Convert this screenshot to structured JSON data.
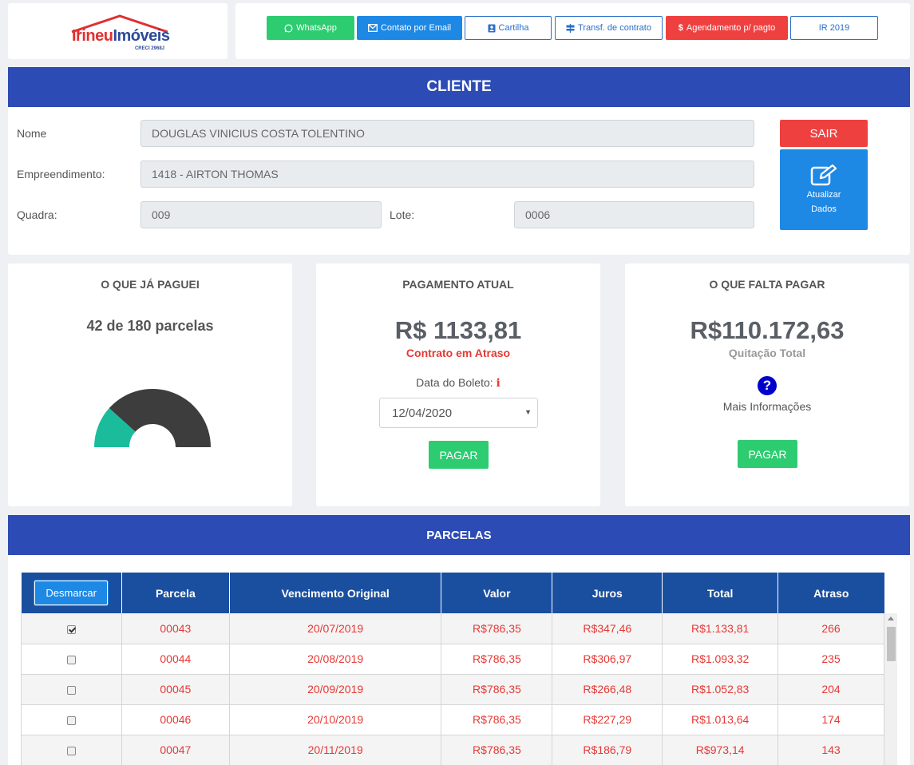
{
  "logo": {
    "brand_part1": "Irineu",
    "brand_part2": "Imóveis",
    "creci": "CRECI 2968J"
  },
  "nav": {
    "whatsapp": "WhatsApp",
    "email": "Contato por Email",
    "cartilha": "Cartilha",
    "transf": "Transf. de contrato",
    "agendamento": "Agendamento p/ pagto",
    "ir": "IR 2019"
  },
  "cliente": {
    "section_title": "CLIENTE",
    "nome_label": "Nome",
    "nome_value": "DOUGLAS VINICIUS COSTA TOLENTINO",
    "empreendimento_label": "Empreendimento:",
    "empreendimento_value": "1418 - AIRTON THOMAS",
    "quadra_label": "Quadra:",
    "quadra_value": "009",
    "lote_label": "Lote:",
    "lote_value": "0006",
    "sair": "SAIR",
    "atualizar_line1": "Atualizar",
    "atualizar_line2": "Dados"
  },
  "paid": {
    "title": "O QUE JÁ PAGUEI",
    "parcels_text": "42 de 180 parcelas",
    "paid_count": 42,
    "total_count": 180,
    "gauge_colors": {
      "paid": "#1abc9c",
      "remaining": "#3d3d3d"
    }
  },
  "current": {
    "title": "PAGAMENTO ATUAL",
    "amount": "R$ 1133,81",
    "status": "Contrato em Atraso",
    "boleto_label": "Data do Boleto:",
    "boleto_info": "i",
    "boleto_date": "12/04/2020",
    "pay": "PAGAR"
  },
  "remaining": {
    "title": "O QUE FALTA PAGAR",
    "amount": "R$110.172,63",
    "status": "Quitação Total",
    "more_info": "Mais Informações",
    "pay": "PAGAR"
  },
  "parcelas": {
    "section_title": "PARCELAS",
    "desmarcar": "Desmarcar",
    "columns": [
      "Parcela",
      "Vencimento Original",
      "Valor",
      "Juros",
      "Total",
      "Atraso"
    ],
    "rows": [
      {
        "checked": true,
        "parcela": "00043",
        "vencimento": "20/07/2019",
        "valor": "R$786,35",
        "juros": "R$347,46",
        "total": "R$1.133,81",
        "atraso": "266"
      },
      {
        "checked": false,
        "parcela": "00044",
        "vencimento": "20/08/2019",
        "valor": "R$786,35",
        "juros": "R$306,97",
        "total": "R$1.093,32",
        "atraso": "235"
      },
      {
        "checked": false,
        "parcela": "00045",
        "vencimento": "20/09/2019",
        "valor": "R$786,35",
        "juros": "R$266,48",
        "total": "R$1.052,83",
        "atraso": "204"
      },
      {
        "checked": false,
        "parcela": "00046",
        "vencimento": "20/10/2019",
        "valor": "R$786,35",
        "juros": "R$227,29",
        "total": "R$1.013,64",
        "atraso": "174"
      },
      {
        "checked": false,
        "parcela": "00047",
        "vencimento": "20/11/2019",
        "valor": "R$786,35",
        "juros": "R$186,79",
        "total": "R$973,14",
        "atraso": "143"
      }
    ]
  },
  "colors": {
    "primary_bar": "#2c4bb5",
    "table_header": "#1a4fa0",
    "danger": "#ef4040",
    "success": "#2ecc71",
    "info": "#1e88e5"
  }
}
